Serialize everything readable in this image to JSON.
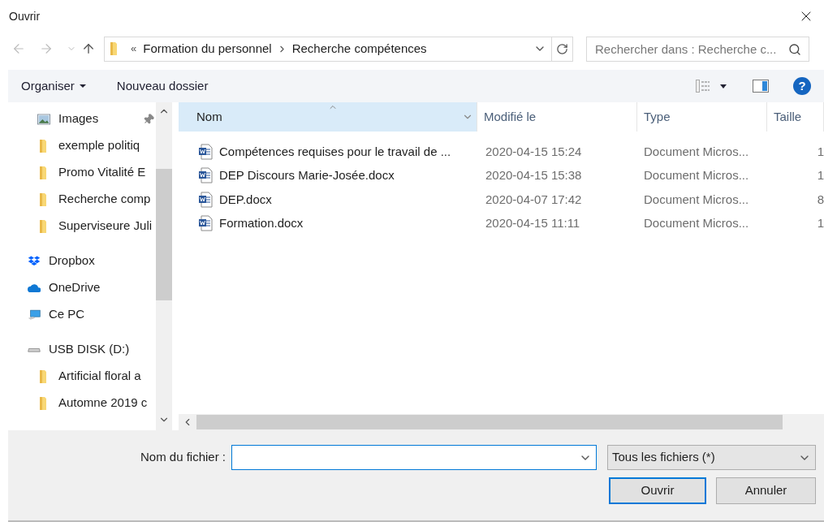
{
  "window": {
    "title": "Ouvrir"
  },
  "address": {
    "prefix": "«",
    "crumbs": [
      "Formation du personnel",
      "Recherche compétences"
    ],
    "search_placeholder": "Rechercher dans : Recherche c..."
  },
  "toolbar": {
    "organize": "Organiser",
    "new_folder": "Nouveau dossier",
    "help": "?"
  },
  "sidebar": {
    "items": [
      {
        "kind": "pictures",
        "label": "Images",
        "pinned": true
      },
      {
        "kind": "folder",
        "label": "exemple politiq",
        "pinned": false
      },
      {
        "kind": "folder",
        "label": "Promo Vitalité E",
        "pinned": false
      },
      {
        "kind": "folder",
        "label": "Recherche comp",
        "pinned": false
      },
      {
        "kind": "folder",
        "label": "Superviseure Juli",
        "pinned": false
      },
      {
        "kind": "dropbox",
        "label": "Dropbox",
        "pinned": false
      },
      {
        "kind": "onedrive",
        "label": "OneDrive",
        "pinned": false
      },
      {
        "kind": "pc",
        "label": "Ce PC",
        "pinned": false
      },
      {
        "kind": "drive",
        "label": "USB DISK (D:)",
        "pinned": false
      },
      {
        "kind": "folder",
        "label": "Artificial floral a",
        "pinned": false
      },
      {
        "kind": "folder",
        "label": "Automne 2019 c",
        "pinned": false
      }
    ]
  },
  "table": {
    "columns": [
      {
        "label": "Nom",
        "selected": true
      },
      {
        "label": "Modifié le",
        "selected": false
      },
      {
        "label": "Type",
        "selected": false
      },
      {
        "label": "Taille",
        "selected": false
      }
    ],
    "rows": [
      {
        "name": "Compétences requises pour le travail de ...",
        "modified": "2020-04-15 15:24",
        "type": "Document Micros...",
        "size": "1"
      },
      {
        "name": "DEP Discours Marie-Josée.docx",
        "modified": "2020-04-15 15:38",
        "type": "Document Micros...",
        "size": "1"
      },
      {
        "name": "DEP.docx",
        "modified": "2020-04-07 17:42",
        "type": "Document Micros...",
        "size": "8"
      },
      {
        "name": "Formation.docx",
        "modified": "2020-04-15 11:11",
        "type": "Document Micros...",
        "size": "1"
      }
    ]
  },
  "footer": {
    "filename_label": "Nom du fichier :",
    "filter": "Tous les fichiers (*)",
    "open": "Ouvrir",
    "cancel": "Annuler"
  }
}
